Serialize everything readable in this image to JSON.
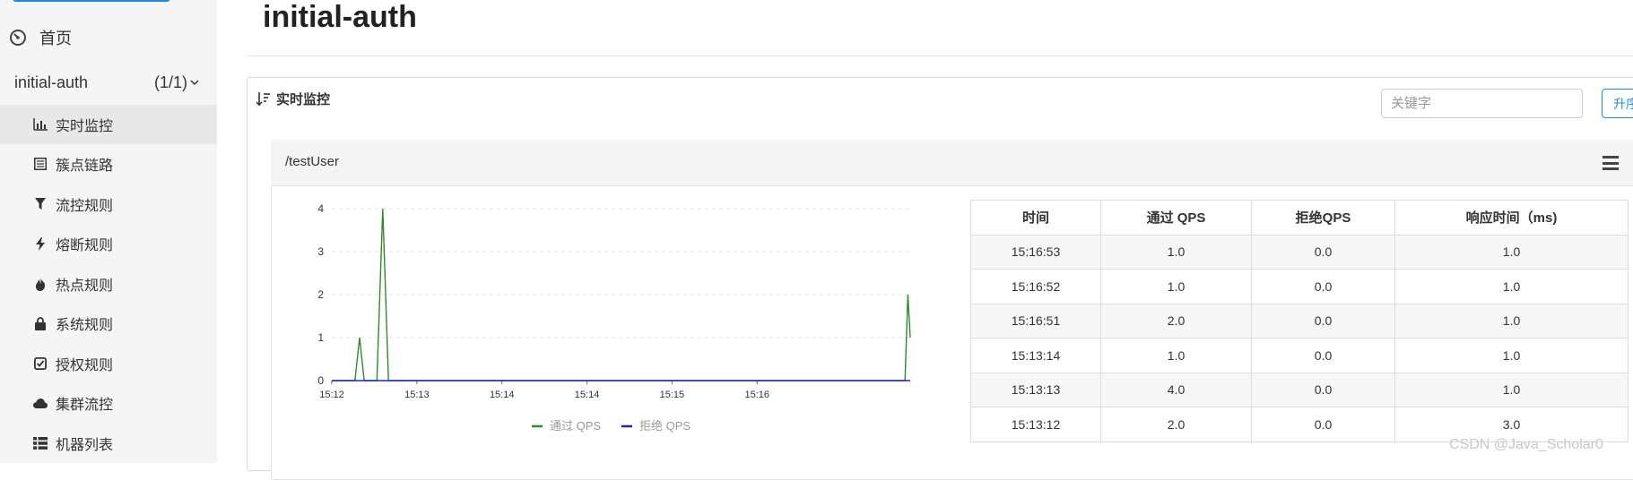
{
  "sidebar": {
    "home_label": "首页",
    "app_name": "initial-auth",
    "app_count": "(1/1)",
    "items": [
      {
        "label": "实时监控",
        "icon": "bar-chart-icon",
        "active": true
      },
      {
        "label": "簇点链路",
        "icon": "list-icon",
        "active": false
      },
      {
        "label": "流控规则",
        "icon": "filter-icon",
        "active": false
      },
      {
        "label": "熔断规则",
        "icon": "flash-icon",
        "active": false
      },
      {
        "label": "热点规则",
        "icon": "fire-icon",
        "active": false
      },
      {
        "label": "系统规则",
        "icon": "lock-icon",
        "active": false
      },
      {
        "label": "授权规则",
        "icon": "check-square-icon",
        "active": false
      },
      {
        "label": "集群流控",
        "icon": "cloud-icon",
        "active": false
      },
      {
        "label": "机器列表",
        "icon": "th-list-icon",
        "active": false
      }
    ]
  },
  "main": {
    "title": "initial-auth",
    "panel_title": "实时监控",
    "search_placeholder": "关键字",
    "sort_button_label": "升序",
    "resource_name": "/testUser"
  },
  "chart_data": {
    "type": "line",
    "x_ticks": [
      "15:12",
      "15:13",
      "15:14",
      "15:14",
      "15:15",
      "15:16"
    ],
    "y_ticks": [
      0,
      1,
      2,
      3,
      4
    ],
    "ylim": [
      0,
      4
    ],
    "series": [
      {
        "name": "通过 QPS",
        "color": "#2e8b2e",
        "points": [
          [
            0,
            0
          ],
          [
            4.0,
            0
          ],
          [
            4.8,
            1
          ],
          [
            5.6,
            0
          ],
          [
            7.8,
            0
          ],
          [
            8.8,
            4
          ],
          [
            9.8,
            0
          ],
          [
            99.1,
            0
          ],
          [
            99.6,
            2
          ],
          [
            100,
            1
          ]
        ]
      },
      {
        "name": "拒绝 QPS",
        "color": "#2222cc",
        "points": [
          [
            0,
            0
          ],
          [
            100,
            0
          ]
        ]
      }
    ]
  },
  "table": {
    "headers": [
      "时间",
      "通过 QPS",
      "拒绝QPS",
      "响应时间（ms)"
    ],
    "rows": [
      [
        "15:16:53",
        "1.0",
        "0.0",
        "1.0"
      ],
      [
        "15:16:52",
        "1.0",
        "0.0",
        "1.0"
      ],
      [
        "15:16:51",
        "2.0",
        "0.0",
        "1.0"
      ],
      [
        "15:13:14",
        "1.0",
        "0.0",
        "1.0"
      ],
      [
        "15:13:13",
        "4.0",
        "0.0",
        "1.0"
      ],
      [
        "15:13:12",
        "2.0",
        "0.0",
        "3.0"
      ]
    ]
  },
  "watermark": "CSDN @Java_Scholar0"
}
